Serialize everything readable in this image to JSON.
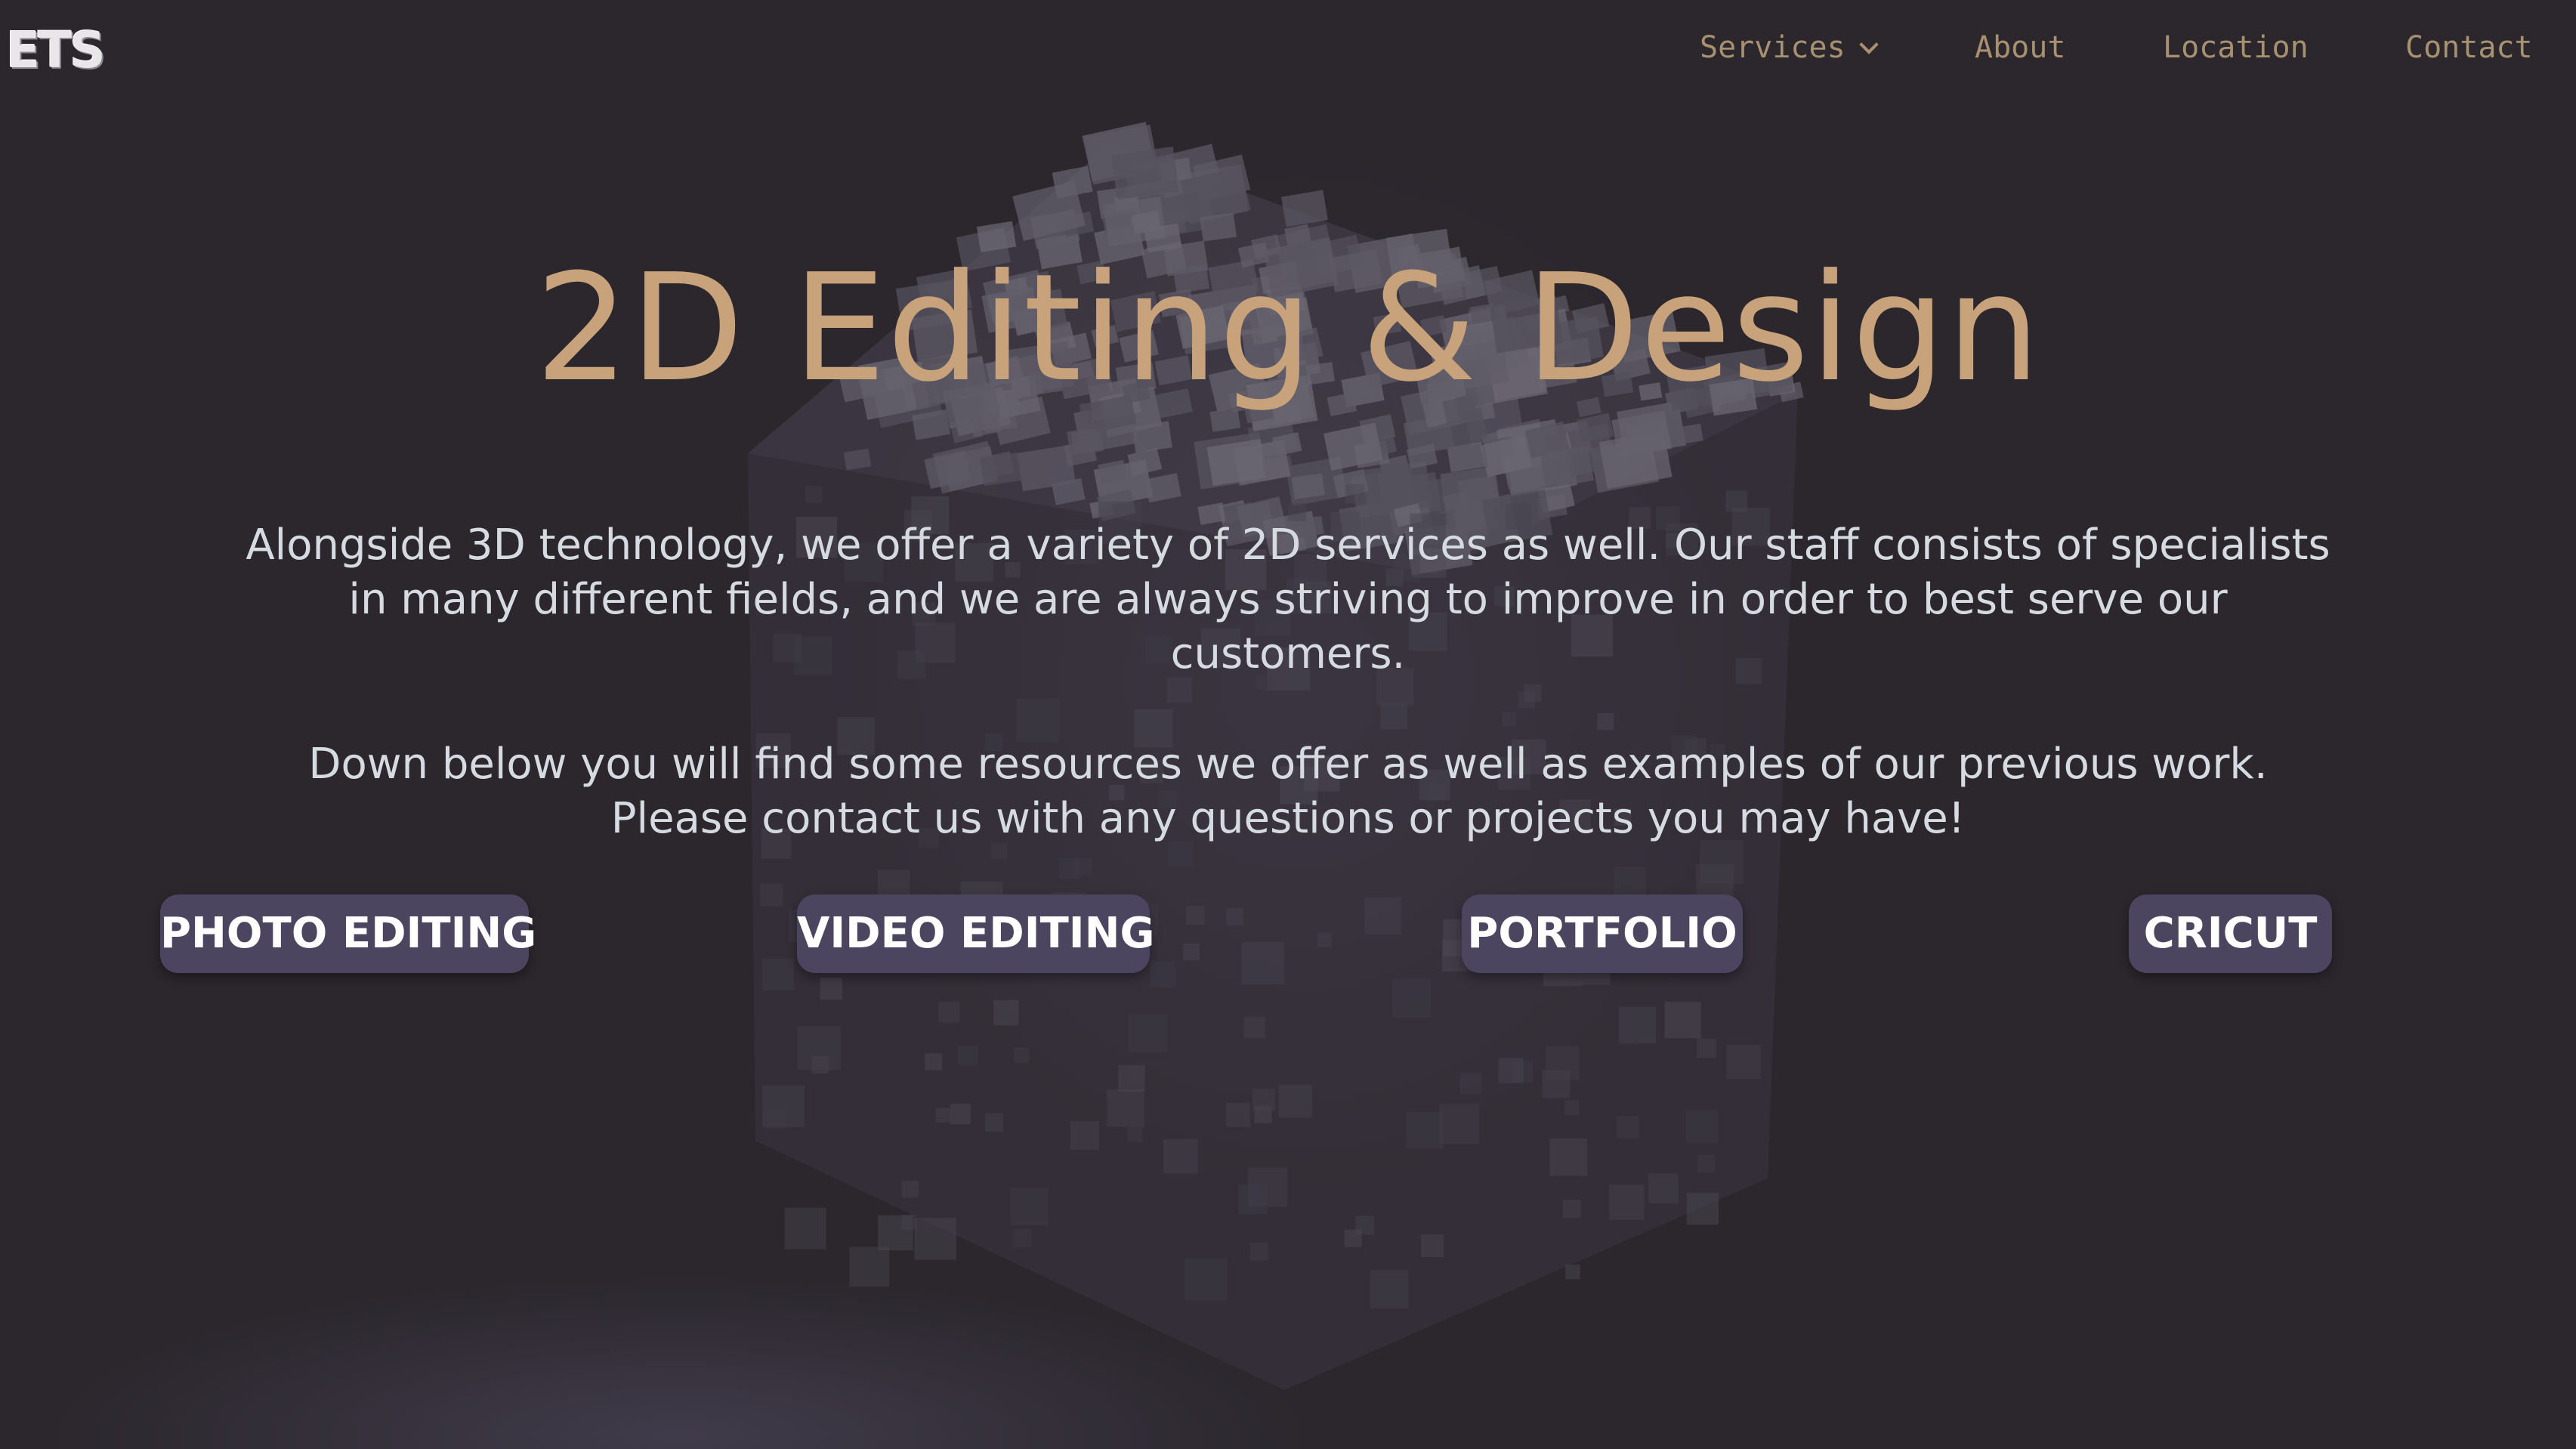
{
  "header": {
    "logo_text": "ETS",
    "nav": {
      "services": "Services",
      "about": "About",
      "location": "Location",
      "contact": "Contact"
    }
  },
  "hero": {
    "title": "2D Editing & Design",
    "paragraph_1": "Alongside 3D technology, we offer a variety of 2D services as well. Our staff consists of specialists in many different fields, and we are always striving to improve in order to best serve our customers.",
    "paragraph_2": "Down below you will find some resources we offer as well as examples of our previous work. Please contact us with any questions or projects you may have!"
  },
  "services": [
    {
      "label": "PHOTO EDITING"
    },
    {
      "label": "VIDEO EDITING"
    },
    {
      "label": "PORTFOLIO"
    },
    {
      "label": "CRICUT"
    }
  ],
  "theme": {
    "background": "#2b272d",
    "title_color": "#c7a27b",
    "nav_color": "#a89170",
    "text_color": "#d5dbe0",
    "button_bg": "#4b4560"
  }
}
